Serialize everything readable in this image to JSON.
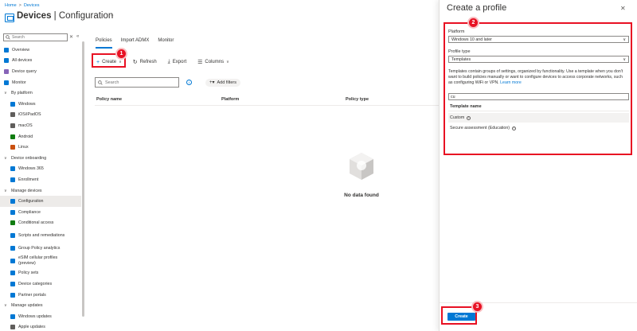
{
  "breadcrumb": {
    "home": "Home",
    "sep": ">",
    "devices": "Devices"
  },
  "page": {
    "title_bold": "Devices",
    "title_rest": " | Configuration",
    "more": "···"
  },
  "sidebar": {
    "search_placeholder": "Search",
    "collapse": "«",
    "items": [
      {
        "label": "Overview",
        "type": "item",
        "color": "#0078d4"
      },
      {
        "label": "All devices",
        "type": "item",
        "color": "#0078d4"
      },
      {
        "label": "Device query",
        "type": "item",
        "color": "#8764b8"
      },
      {
        "label": "Monitor",
        "type": "item",
        "color": "#0078d4"
      },
      {
        "label": "By platform",
        "type": "group"
      },
      {
        "label": "Windows",
        "type": "sub",
        "color": "#0078d4"
      },
      {
        "label": "iOS/iPadOS",
        "type": "sub",
        "color": "#605e5c"
      },
      {
        "label": "macOS",
        "type": "sub",
        "color": "#605e5c"
      },
      {
        "label": "Android",
        "type": "sub",
        "color": "#107c10"
      },
      {
        "label": "Linux",
        "type": "sub",
        "color": "#ca5010"
      },
      {
        "label": "Device onboarding",
        "type": "group"
      },
      {
        "label": "Windows 365",
        "type": "sub",
        "color": "#0078d4"
      },
      {
        "label": "Enrollment",
        "type": "sub",
        "color": "#0078d4"
      },
      {
        "label": "Manage devices",
        "type": "group"
      },
      {
        "label": "Configuration",
        "type": "sub",
        "color": "#0078d4",
        "active": true
      },
      {
        "label": "Compliance",
        "type": "sub",
        "color": "#0078d4"
      },
      {
        "label": "Conditional access",
        "type": "sub",
        "color": "#107c10"
      },
      {
        "label": "Scripts and remediations",
        "type": "sub",
        "color": "#0078d4",
        "tall": true
      },
      {
        "label": "Group Policy analytics",
        "type": "sub",
        "color": "#0078d4"
      },
      {
        "label": "eSIM cellular profiles (preview)",
        "type": "sub",
        "color": "#0078d4",
        "tall": true
      },
      {
        "label": "Policy sets",
        "type": "sub",
        "color": "#0078d4"
      },
      {
        "label": "Device categories",
        "type": "sub",
        "color": "#0078d4"
      },
      {
        "label": "Partner portals",
        "type": "sub",
        "color": "#0078d4"
      },
      {
        "label": "Manage updates",
        "type": "group"
      },
      {
        "label": "Windows updates",
        "type": "sub",
        "color": "#0078d4"
      },
      {
        "label": "Apple updates",
        "type": "sub",
        "color": "#605e5c"
      }
    ]
  },
  "tabs": [
    {
      "label": "Policies",
      "active": true
    },
    {
      "label": "Import ADMX"
    },
    {
      "label": "Monitor"
    }
  ],
  "toolbar": {
    "create": "Create",
    "create_glyph": "+",
    "refresh": "Refresh",
    "export": "Export",
    "columns": "Columns"
  },
  "filter": {
    "search_placeholder": "Search",
    "add_filters": "Add filters"
  },
  "table": {
    "columns": [
      "Policy name",
      "Platform",
      "Policy type"
    ]
  },
  "empty": {
    "text": "No data found"
  },
  "panel": {
    "title": "Create a profile",
    "close": "✕",
    "platform_label": "Platform",
    "platform_value": "Windows 10 and later",
    "profile_type_label": "Profile type",
    "profile_type_value": "Templates",
    "description": "Templates contain groups of settings, organized by functionality. Use a template when you don't want to build policies manually or want to configure devices to access corporate networks, such as configuring WiFi or VPN.",
    "learn_more": "Learn more",
    "template_search": "cu",
    "template_header": "Template name",
    "templates": [
      {
        "label": "Custom",
        "selected": true
      },
      {
        "label": "Secure assessment (Education)",
        "selected": false
      }
    ],
    "create_button": "Create"
  },
  "annotations": {
    "badge1": "1",
    "badge2": "2",
    "badge3": "3",
    "color": "#e81123"
  },
  "colors": {
    "accent": "#0078d4",
    "annotation": "#e81123"
  }
}
